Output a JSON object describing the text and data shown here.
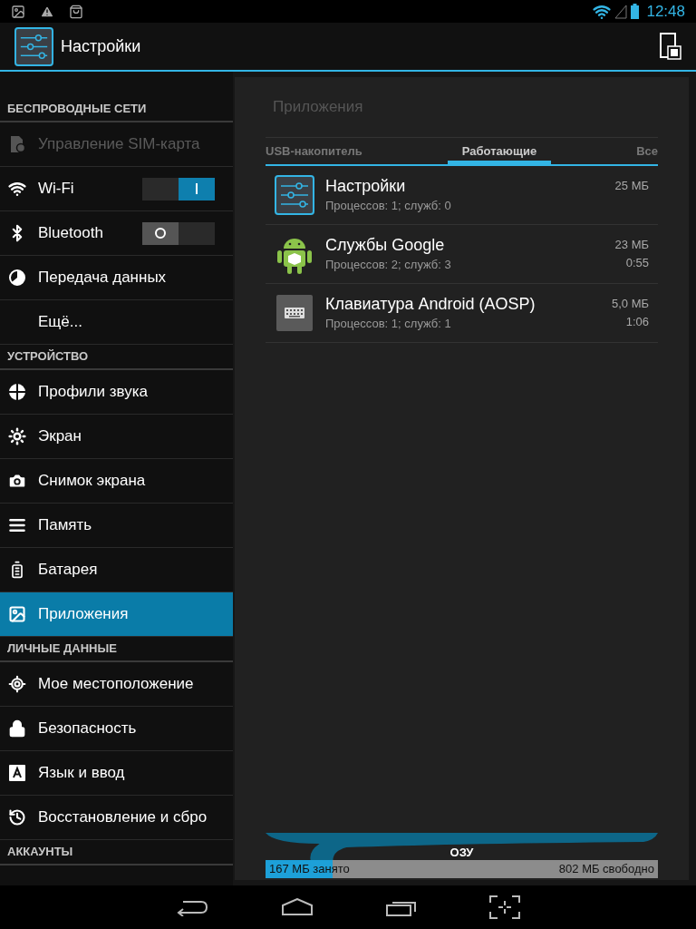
{
  "status_bar": {
    "time": "12:48"
  },
  "action_bar": {
    "title": "Настройки"
  },
  "sidebar": {
    "items": [
      {
        "kind": "header",
        "label": "БЕСПРОВОДНЫЕ СЕТИ"
      },
      {
        "kind": "item",
        "label": "Управление SIM-карта",
        "selected": false,
        "disabled": true
      },
      {
        "kind": "toggle",
        "label": "Wi-Fi",
        "on": true,
        "selected": false,
        "disabled": false
      },
      {
        "kind": "toggle",
        "label": "Bluetooth",
        "on": false,
        "selected": false,
        "disabled": false
      },
      {
        "kind": "item",
        "label": "Передача данных",
        "selected": false,
        "disabled": false
      },
      {
        "kind": "item",
        "label": "Ещё...",
        "selected": false,
        "disabled": false
      },
      {
        "kind": "header",
        "label": "УСТРОЙСТВО"
      },
      {
        "kind": "item",
        "label": "Профили звука",
        "selected": false,
        "disabled": false
      },
      {
        "kind": "item",
        "label": "Экран",
        "selected": false,
        "disabled": false
      },
      {
        "kind": "item",
        "label": "Снимок экрана",
        "selected": false,
        "disabled": false
      },
      {
        "kind": "item",
        "label": "Память",
        "selected": false,
        "disabled": false
      },
      {
        "kind": "item",
        "label": "Батарея",
        "selected": false,
        "disabled": false
      },
      {
        "kind": "item",
        "label": "Приложения",
        "selected": true,
        "disabled": false
      },
      {
        "kind": "header",
        "label": "ЛИЧНЫЕ ДАННЫЕ"
      },
      {
        "kind": "item",
        "label": "Мое местоположение",
        "selected": false,
        "disabled": false
      },
      {
        "kind": "item",
        "label": "Безопасность",
        "selected": false,
        "disabled": false
      },
      {
        "kind": "item",
        "label": "Язык и ввод",
        "selected": false,
        "disabled": false
      },
      {
        "kind": "item",
        "label": "Восстановление и сбро",
        "selected": false,
        "disabled": false
      },
      {
        "kind": "header",
        "label": "АККАУНТЫ"
      }
    ]
  },
  "content": {
    "title": "Приложения",
    "tabs": [
      {
        "label": "USB-накопитель",
        "selected": false
      },
      {
        "label": "Работающие",
        "selected": true
      },
      {
        "label": "Все",
        "selected": false
      }
    ],
    "apps": [
      {
        "name": "Настройки",
        "detail": "Процессов: 1; служб: 0",
        "size": "25 МБ"
      },
      {
        "name": "Службы Google",
        "detail": "Процессов: 2; служб: 3",
        "size": "23 МБ",
        "time": "0:55"
      },
      {
        "name": "Клавиатура Android (AOSP)",
        "detail": "Процессов: 1; служб: 1",
        "size": "5,0 МБ",
        "time": "1:06"
      }
    ],
    "ram": {
      "label": "ОЗУ",
      "used": "167 МБ занято",
      "free": "802 МБ свободно",
      "level": 0.17
    }
  }
}
